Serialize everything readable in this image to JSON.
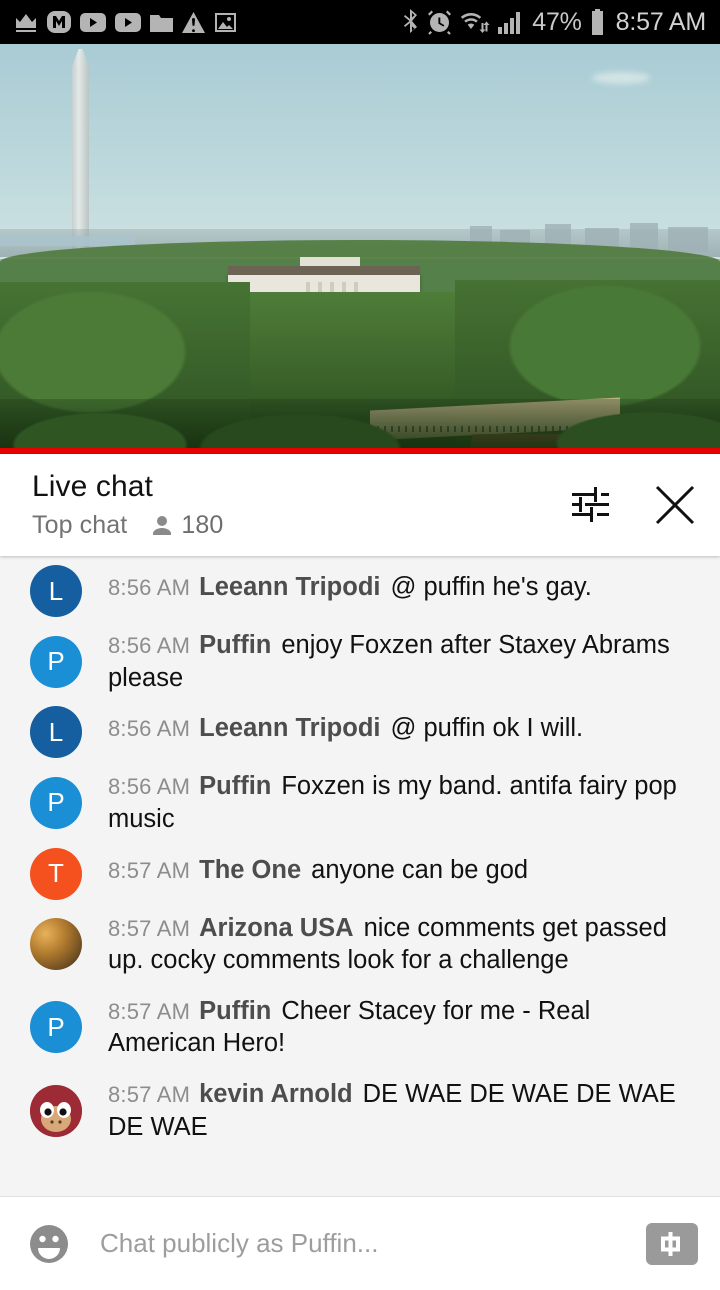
{
  "status_bar": {
    "left_icons": [
      {
        "name": "crown-icon"
      },
      {
        "name": "m-app-icon"
      },
      {
        "name": "youtube-play-icon-1"
      },
      {
        "name": "youtube-play-icon-2"
      },
      {
        "name": "folder-icon"
      },
      {
        "name": "warning-triangle-icon"
      },
      {
        "name": "image-icon"
      }
    ],
    "right_icons": [
      {
        "name": "bluetooth-icon"
      },
      {
        "name": "alarm-clock-icon"
      },
      {
        "name": "wifi-transfer-icon"
      },
      {
        "name": "cellular-signal-icon"
      }
    ],
    "battery_percent": "47%",
    "battery_icon": "battery-icon",
    "clock": "8:57 AM"
  },
  "video": {
    "scene_description": "White House with Washington Monument",
    "progress_percent": 100,
    "progress_color": "#e60000"
  },
  "chat_header": {
    "title": "Live chat",
    "mode": "Top chat",
    "viewer_icon": "person-icon",
    "viewer_count": "180",
    "settings_icon": "tune-sliders-icon",
    "close_icon": "close-icon"
  },
  "messages": [
    {
      "time": "8:56 AM",
      "author": "Leeann Tripodi",
      "text": "@ puffin he's gay.",
      "avatar_letter": "L",
      "avatar_color": "#155ea0",
      "avatar_type": "letter"
    },
    {
      "time": "8:56 AM",
      "author": "Puffin",
      "text": "enjoy Foxzen after Staxey Abrams please",
      "avatar_letter": "P",
      "avatar_color": "#1b8fd6",
      "avatar_type": "letter"
    },
    {
      "time": "8:56 AM",
      "author": "Leeann Tripodi",
      "text": "@ puffin ok I will.",
      "avatar_letter": "L",
      "avatar_color": "#155ea0",
      "avatar_type": "letter"
    },
    {
      "time": "8:56 AM",
      "author": "Puffin",
      "text": "Foxzen is my band. antifa fairy pop music",
      "avatar_letter": "P",
      "avatar_color": "#1b8fd6",
      "avatar_type": "letter"
    },
    {
      "time": "8:57 AM",
      "author": "The One",
      "text": "anyone can be god",
      "avatar_letter": "T",
      "avatar_color": "#f4511e",
      "avatar_type": "letter"
    },
    {
      "time": "8:57 AM",
      "author": "Arizona USA",
      "text": "nice comments get passed up. cocky comments look for a challenge",
      "avatar_letter": "",
      "avatar_color": "#8b6430",
      "avatar_type": "photo-landscape"
    },
    {
      "time": "8:57 AM",
      "author": "Puffin",
      "text": "Cheer Stacey for me - Real American Hero!",
      "avatar_letter": "P",
      "avatar_color": "#1b8fd6",
      "avatar_type": "letter"
    },
    {
      "time": "8:57 AM",
      "author": "kevin Arnold",
      "text": "DE WAE DE WAE DE WAE DE WAE",
      "avatar_letter": "",
      "avatar_color": "#9c2b36",
      "avatar_type": "photo-knuckles"
    }
  ],
  "composer": {
    "emoji_icon": "emoji-smiley-icon",
    "placeholder": "Chat publicly as Puffin...",
    "value": "",
    "superchat_icon": "superchat-dollar-icon"
  }
}
